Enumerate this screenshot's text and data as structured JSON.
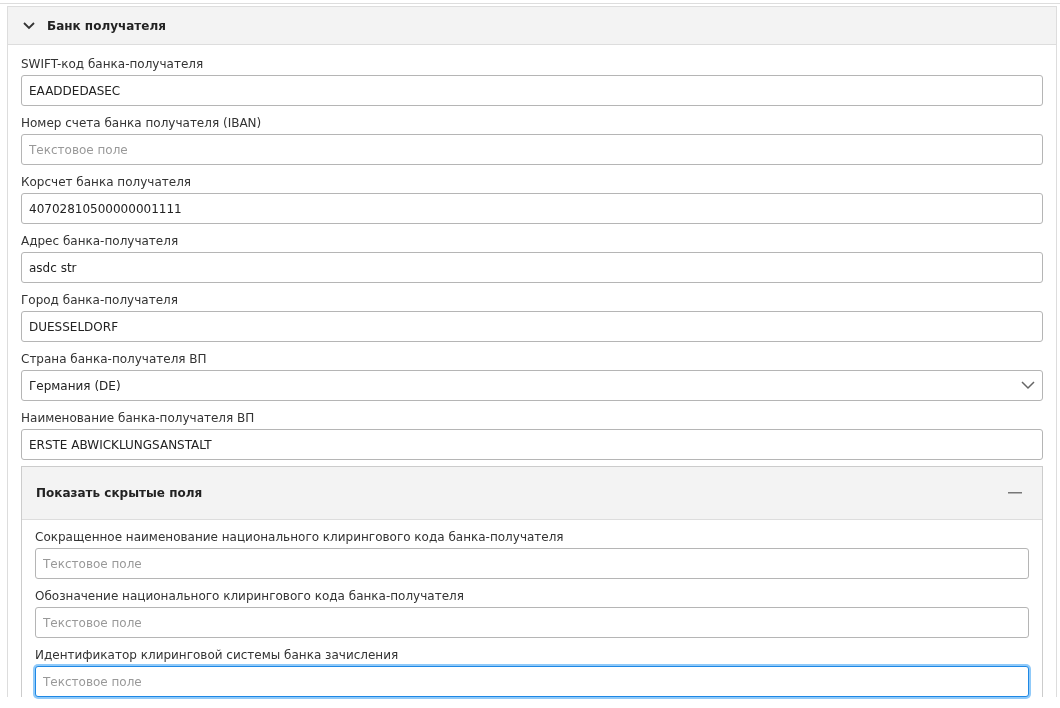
{
  "section": {
    "title": "Банк получателя",
    "expanded": true,
    "fields": [
      {
        "label": "SWIFT-код банка-получателя",
        "kind": "text",
        "value": "EAADDEDASEC",
        "focused": false
      },
      {
        "label": "Номер счета банка получателя (IBAN)",
        "kind": "text",
        "placeholder": "Текстовое поле",
        "focused": false
      },
      {
        "label": "Корсчет банка получателя",
        "kind": "text",
        "value": "40702810500000001111",
        "focused": false
      },
      {
        "label": "Адрес банка-получателя",
        "kind": "text",
        "value": "asdc str",
        "focused": false
      },
      {
        "label": "Город банка-получателя",
        "kind": "text",
        "value": "DUESSELDORF",
        "focused": false
      },
      {
        "label": "Страна банка-получателя ВП",
        "kind": "select",
        "value": "Германия (DE)",
        "focused": false
      },
      {
        "label": "Наименование банка-получателя ВП",
        "kind": "text",
        "value": "ERSTE ABWICKLUNGSANSTALT",
        "focused": false
      }
    ],
    "subsection": {
      "title": "Показать скрытые поля",
      "expanded": true,
      "fields": [
        {
          "label": "Сокращенное наименование национального клирингового кода банка-получателя",
          "kind": "text",
          "placeholder": "Текстовое поле",
          "focused": false
        },
        {
          "label": "Обозначение национального клирингового кода банка-получателя",
          "kind": "text",
          "placeholder": "Текстовое поле",
          "focused": false
        },
        {
          "label": "Идентификатор клиринговой системы банка зачисления",
          "kind": "text",
          "placeholder": "Текстовое поле",
          "focused": true
        }
      ]
    }
  }
}
